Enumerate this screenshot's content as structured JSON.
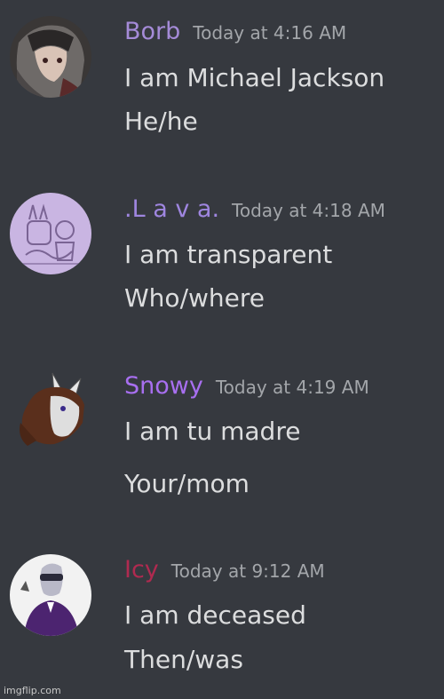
{
  "colors": {
    "background": "#36393f",
    "message_text": "#dcddde",
    "timestamp": "#a3a6aa"
  },
  "messages": [
    {
      "username": "Borb",
      "username_color": "#a58bd8",
      "timestamp": "Today at 4:16 AM",
      "lines": [
        "I am Michael Jackson",
        "He/he"
      ],
      "avatar_icon": "anime-character-avatar"
    },
    {
      "username": ".L a v a.",
      "username_color": "#9f86e0",
      "timestamp": "Today at 4:18 AM",
      "lines": [
        "I am transparent",
        "Who/where"
      ],
      "avatar_icon": "purple-sketch-avatar"
    },
    {
      "username": "Snowy",
      "username_color": "#a86ff0",
      "timestamp": "Today at 4:19 AM",
      "lines": [
        "I am tu madre",
        "Your/mom"
      ],
      "avatar_icon": "wolf-character-avatar"
    },
    {
      "username": "Icy",
      "username_color": "#b02a50",
      "timestamp": "Today at 9:12 AM",
      "lines": [
        "I am deceased",
        "Then/was"
      ],
      "avatar_icon": "purple-suit-character-avatar"
    }
  ],
  "watermark": "imgflip.com"
}
